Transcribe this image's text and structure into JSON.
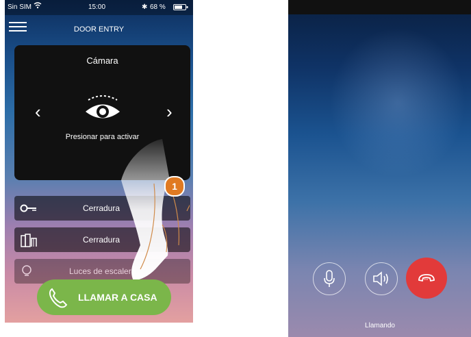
{
  "left_screen": {
    "status_bar": {
      "carrier": "Sin SIM",
      "time": "15:00",
      "battery": "68 %"
    },
    "header": {
      "title": "DOOR ENTRY"
    },
    "camera": {
      "label": "Cámara",
      "hint": "Presionar para activar",
      "prev_icon": "chevron-left-icon",
      "next_icon": "chevron-right-icon",
      "activate_icon": "eye-icon"
    },
    "rows": [
      {
        "label": "Cerradura",
        "icon": "key-icon"
      },
      {
        "label": "Cerradura",
        "icon": "gate-icon"
      },
      {
        "label": "Luces de escalera",
        "icon": "bulb-icon"
      }
    ],
    "call_button": {
      "label": "LLAMAR A CASA",
      "icon": "phone-icon",
      "color": "#7bb64a"
    },
    "step_badge": "1"
  },
  "right_screen": {
    "controls": [
      {
        "name": "microphone",
        "icon": "microphone-icon"
      },
      {
        "name": "speaker",
        "icon": "speaker-icon"
      },
      {
        "name": "hang-up",
        "icon": "hang-up-icon",
        "color": "#e23a3a"
      }
    ],
    "status_text": "Llamando"
  }
}
